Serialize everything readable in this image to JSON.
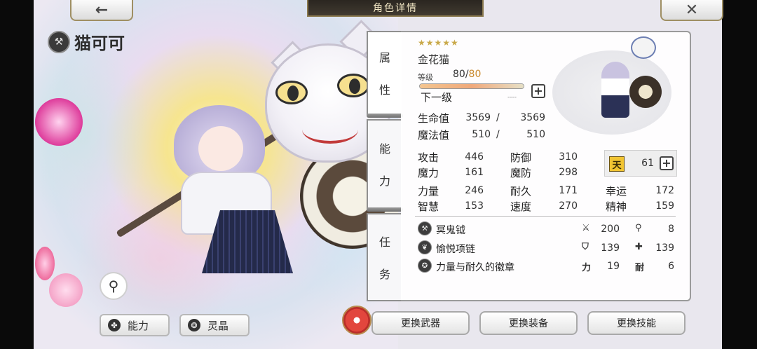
{
  "header": {
    "title": "角色详情",
    "back_icon": "←",
    "close_icon": "✕"
  },
  "character": {
    "name": "猫可可",
    "name_icon": "weapon-emblem-icon"
  },
  "tabs": [
    {
      "label_1": "属",
      "label_2": "性"
    },
    {
      "label_1": "能",
      "label_2": "力"
    },
    {
      "label_1": "任",
      "label_2": "务"
    }
  ],
  "attributes": {
    "stars": "★★★★★",
    "class_name": "金花猫",
    "level_label": "等级",
    "level": "80",
    "level_max": "80",
    "level_progress": 1.0,
    "next_level_label": "下一级",
    "next_level_placeholder": "----"
  },
  "vitals": [
    {
      "label": "生命值",
      "current": "3569",
      "max": "3569"
    },
    {
      "label": "魔法值",
      "current": "510",
      "max": "510"
    }
  ],
  "stats": {
    "attack": {
      "label": "攻击",
      "value": "446"
    },
    "defense": {
      "label": "防御",
      "value": "310"
    },
    "magic": {
      "label": "魔力",
      "value": "161"
    },
    "magic_def": {
      "label": "魔防",
      "value": "298"
    },
    "strength": {
      "label": "力量",
      "value": "246"
    },
    "endurance": {
      "label": "耐久",
      "value": "171"
    },
    "luck": {
      "label": "幸运",
      "value": "172"
    },
    "wisdom": {
      "label": "智慧",
      "value": "153"
    },
    "speed": {
      "label": "速度",
      "value": "270"
    },
    "spirit": {
      "label": "精神",
      "value": "159"
    },
    "heaven": {
      "glyph": "天",
      "value": "61"
    }
  },
  "equipment": [
    {
      "name": "冥鬼钺",
      "icon": "axe-icon",
      "stat1_icon": "sword-icon",
      "stat1": "200",
      "stat2_icon": "staff-icon",
      "stat2": "8"
    },
    {
      "name": "愉悦项链",
      "icon": "necklace-icon",
      "stat1_icon": "shield-icon",
      "stat1": "139",
      "stat2_icon": "shield-cross-icon",
      "stat2": "139"
    },
    {
      "name": "力量与耐久的徽章",
      "icon": "badge-icon",
      "stat1_icon": "力",
      "stat1": "19",
      "stat2_icon": "耐",
      "stat2": "6"
    }
  ],
  "bottom": {
    "ability_label": "能力",
    "crystal_label": "灵晶",
    "change_weapon": "更换武器",
    "change_equipment": "更换装备",
    "change_skill": "更换技能"
  },
  "colors": {
    "accent_gold": "#c9a94a",
    "level_max": "#c98a2e",
    "heaven_yellow": "#f1c431"
  }
}
